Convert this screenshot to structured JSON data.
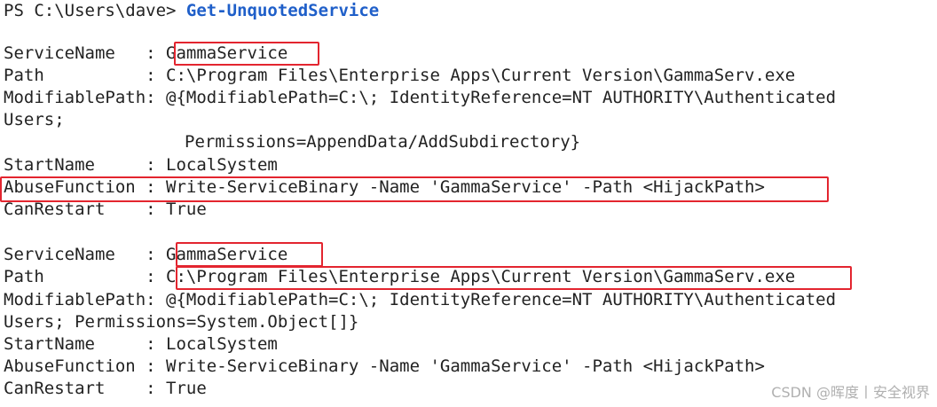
{
  "prompt": {
    "prefix": "PS C:\\Users\\dave> ",
    "command": "Get-UnquotedService"
  },
  "records": [
    {
      "service_name_key": "ServiceName",
      "service_name": "GammaService",
      "path_key": "Path",
      "path": "C:\\Program Files\\Enterprise Apps\\Current Version\\GammaServ.exe",
      "modifiable_path_key": "ModifiablePath",
      "modifiable_path_line1": "@{ModifiablePath=C:\\; IdentityReference=NT AUTHORITY\\Authenticated",
      "modifiable_path_line2": "Users;",
      "modifiable_path_line3": "Permissions=AppendData/AddSubdirectory}",
      "start_name_key": "StartName",
      "start_name": "LocalSystem",
      "abuse_function_key": "AbuseFunction",
      "abuse_function": "Write-ServiceBinary -Name 'GammaService' -Path <HijackPath>",
      "can_restart_key": "CanRestart",
      "can_restart": "True"
    },
    {
      "service_name_key": "ServiceName",
      "service_name": "GammaService",
      "path_key": "Path",
      "path": "C:\\Program Files\\Enterprise Apps\\Current Version\\GammaServ.exe",
      "modifiable_path_key": "ModifiablePath",
      "modifiable_path_line1": "@{ModifiablePath=C:\\; IdentityReference=NT AUTHORITY\\Authenticated",
      "modifiable_path_line2": "Users; Permissions=System.Object[]}",
      "start_name_key": "StartName",
      "start_name": "LocalSystem",
      "abuse_function_key": "AbuseFunction",
      "abuse_function": "Write-ServiceBinary -Name 'GammaService' -Path <HijackPath>",
      "can_restart_key": "CanRestart",
      "can_restart": "True"
    }
  ],
  "separator": ": ",
  "colors": {
    "command": "#1f5fc9",
    "highlight_box": "#e3252f",
    "text": "#222222"
  },
  "watermark": "CSDN @晖度丨安全视界"
}
